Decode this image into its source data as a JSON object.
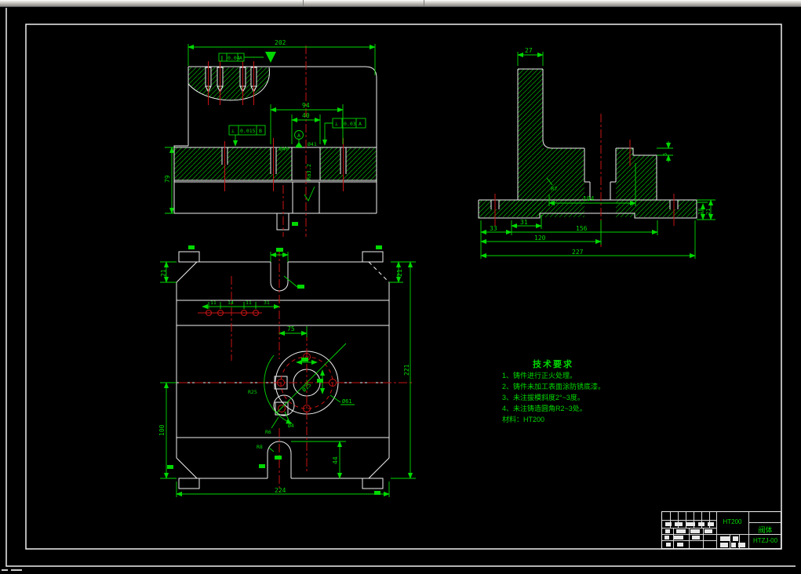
{
  "colors": {
    "background": "#000000",
    "line_green": "#00d800",
    "line_white": "#f0f0f0",
    "centerline_red": "#c81414"
  },
  "views": {
    "front": {
      "dim_202": "202",
      "dim_79": "79",
      "dim_94": "94",
      "dim_40": "40",
      "dia_40": "Ø40",
      "dia_41": "Ø41",
      "roughness": "Ra3.2",
      "fcf_parallelism": {
        "symbol": "∥",
        "tolerance": "0.04",
        "datum": "A"
      },
      "fcf_perpendicularity_1": {
        "symbol": "⊥",
        "tolerance": "0.015",
        "datum": "B"
      },
      "fcf_perpendicularity_2": {
        "symbol": "⊥",
        "tolerance": "0.03",
        "datum": "A"
      },
      "datum_label": "A"
    },
    "side": {
      "dim_27": "27",
      "radius_r7": "R7",
      "dim_5": "5",
      "dim_104": "104",
      "dim_33": "33",
      "dim_31": "31",
      "dim_156": "156",
      "dim_120": "120",
      "dim_227": "227",
      "dim_18": "18",
      "dim_21": "21"
    },
    "plan": {
      "dim_21_left": "21",
      "dim_21_right": "21",
      "dim_11_a": "11",
      "dim_14": "14",
      "dim_11_b": "11",
      "dim_31": "31",
      "dim_75": "75",
      "dim_221": "221",
      "dim_100": "100",
      "dim_224": "224",
      "dim_44": "44",
      "dia_61": "Ø61",
      "dia_25": "Ø25",
      "dia_4": "Ø4",
      "radius_r6": "R6",
      "radius_r25": "R25",
      "radius_r8": "R8"
    }
  },
  "tech_requirements": {
    "title": "技术要求",
    "items": [
      "1、铸件进行正火处理。",
      "2、铸件未加工表面涂防锈底漆。",
      "3、未注拔模斜度2°~3度。",
      "4、未注铸造圆角R2~3处。"
    ],
    "material": "材料：HT200"
  },
  "title_block": {
    "material": "HT200",
    "part_name": "阀体",
    "drawing_no": "HTZJ-00"
  }
}
